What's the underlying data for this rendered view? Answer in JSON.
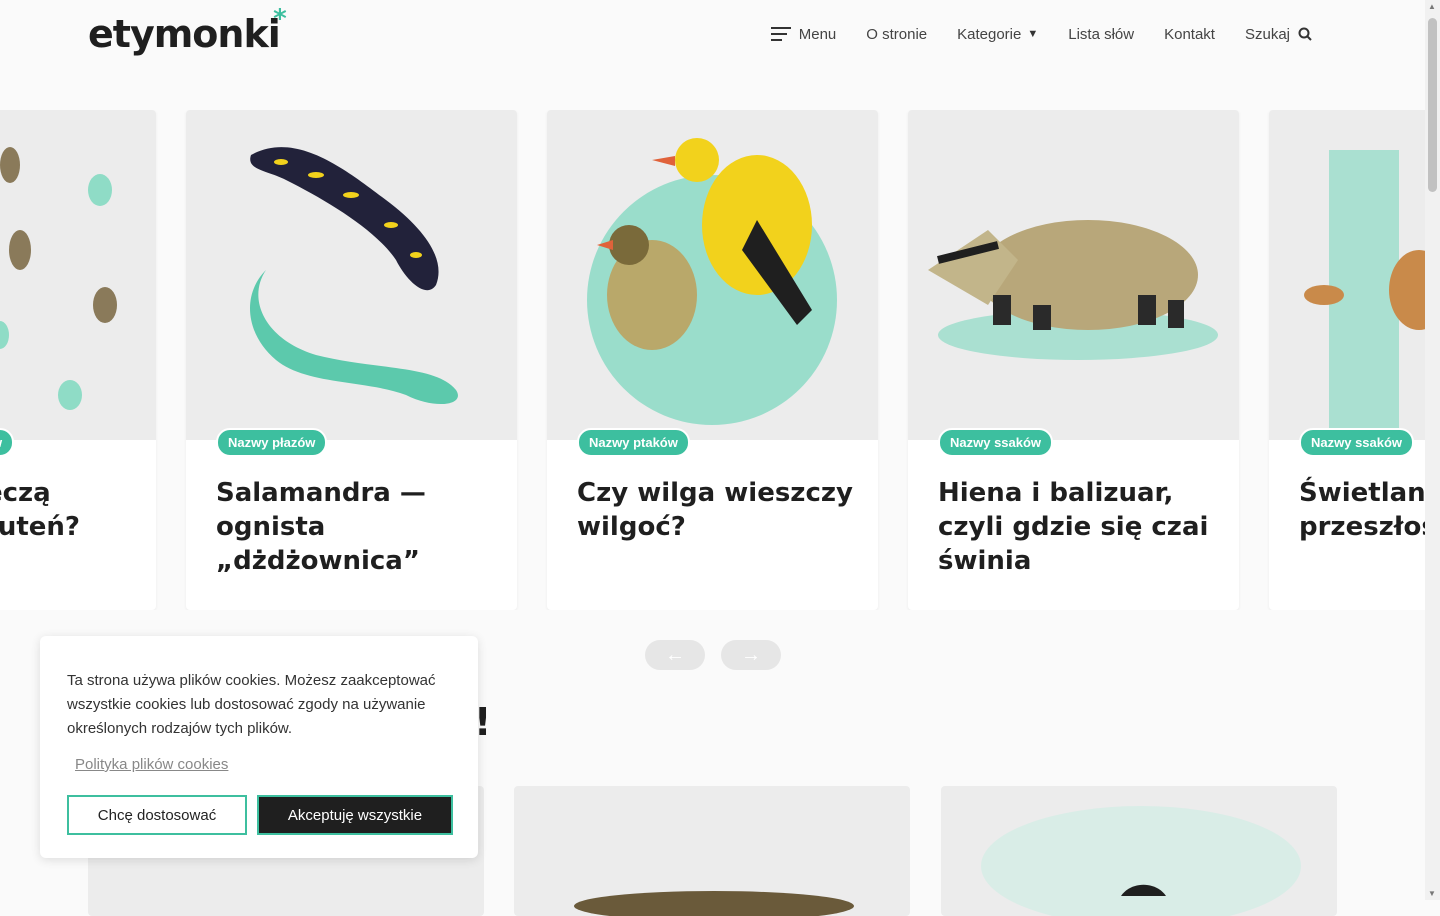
{
  "header": {
    "logo_text": "etymonki",
    "logo_mark": "*",
    "nav": {
      "menu": "Menu",
      "about": "O stronie",
      "categories": "Kategorie",
      "word_list": "Lista słów",
      "contact": "Kontakt",
      "search": "Szukaj"
    }
  },
  "carousel": {
    "cards": [
      {
        "tag": "w",
        "title": "ęczą\nruteń?"
      },
      {
        "tag": "Nazwy płazów",
        "title": "Salamandra — ognista „dżdżownica”"
      },
      {
        "tag": "Nazwy ptaków",
        "title": "Czy wilga wieszczy wilgoć?"
      },
      {
        "tag": "Nazwy ssaków",
        "title": "Hiena i balizuar, czyli gdzie się czai świnia"
      },
      {
        "tag": "Nazwy ssaków",
        "title": "Świetlana przeszłość"
      }
    ],
    "prev_label": "←",
    "next_label": "→"
  },
  "section": {
    "heading_tail": "!"
  },
  "cookie": {
    "text": "Ta strona używa plików cookies. Możesz zaakceptować wszystkie cookies lub dostosować zgody na używanie określonych rodzajów tych plików.",
    "policy_link": "Polityka plików cookies",
    "customize": "Chcę dostosować",
    "accept_all": "Akceptuję wszystkie"
  },
  "colors": {
    "accent": "#3dbf9f",
    "dark": "#1f1f1f",
    "bg": "#fafafa"
  }
}
